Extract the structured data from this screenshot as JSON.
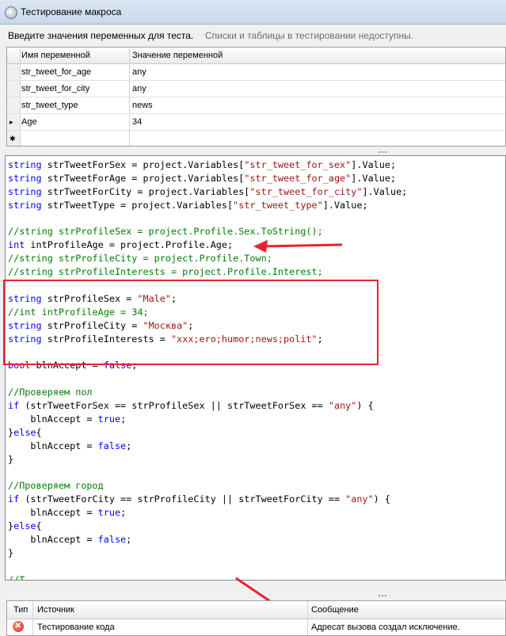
{
  "window": {
    "title": "Тестирование макроса",
    "icon": "gear-icon"
  },
  "info": {
    "main": "Введите значения переменных для теста.",
    "secondary": "Списки и таблицы в тестировании недоступны."
  },
  "variables": {
    "columns": [
      "Имя переменной",
      "Значение переменной"
    ],
    "rows": [
      {
        "name": "str_tweet_for_age",
        "value": "any"
      },
      {
        "name": "str_tweet_for_city",
        "value": "any"
      },
      {
        "name": "str_tweet_type",
        "value": "news"
      },
      {
        "name": "Age",
        "value": "34"
      }
    ],
    "current_row_marker": "▸",
    "new_row_marker": "✱"
  },
  "code_lines": [
    [
      [
        "kw",
        "string"
      ],
      [
        "t",
        " strTweetForSex = project.Variables["
      ],
      [
        "str",
        "\"str_tweet_for_sex\""
      ],
      [
        "t",
        "].Value;"
      ]
    ],
    [
      [
        "kw",
        "string"
      ],
      [
        "t",
        " strTweetForAge = project.Variables["
      ],
      [
        "str",
        "\"str_tweet_for_age\""
      ],
      [
        "t",
        "].Value;"
      ]
    ],
    [
      [
        "kw",
        "string"
      ],
      [
        "t",
        " strTweetForCity = project.Variables["
      ],
      [
        "str",
        "\"str_tweet_for_city\""
      ],
      [
        "t",
        "].Value;"
      ]
    ],
    [
      [
        "kw",
        "string"
      ],
      [
        "t",
        " strTweetType = project.Variables["
      ],
      [
        "str",
        "\"str_tweet_type\""
      ],
      [
        "t",
        "].Value;"
      ]
    ],
    [],
    [
      [
        "cm",
        "//string strProfileSex = project.Profile.Sex.ToString();"
      ]
    ],
    [
      [
        "kw",
        "int"
      ],
      [
        "t",
        " intProfileAge = project.Profile.Age;"
      ]
    ],
    [
      [
        "cm",
        "//string strProfileCity = project.Profile.Town;"
      ]
    ],
    [
      [
        "cm",
        "//string strProfileInterests = project.Profile.Interest;"
      ]
    ],
    [],
    [
      [
        "kw",
        "string"
      ],
      [
        "t",
        " strProfileSex = "
      ],
      [
        "str",
        "\"Male\""
      ],
      [
        "t",
        ";"
      ]
    ],
    [
      [
        "cm",
        "//int intProfileAge = 34;"
      ]
    ],
    [
      [
        "kw",
        "string"
      ],
      [
        "t",
        " strProfileCity = "
      ],
      [
        "str",
        "\"Москва\""
      ],
      [
        "t",
        ";"
      ]
    ],
    [
      [
        "kw",
        "string"
      ],
      [
        "t",
        " strProfileInterests = "
      ],
      [
        "str",
        "\"xxx;ero;humor;news;polit\""
      ],
      [
        "t",
        ";"
      ]
    ],
    [],
    [
      [
        "kw",
        "bool"
      ],
      [
        "t",
        " blnAccept = "
      ],
      [
        "kw",
        "false"
      ],
      [
        "t",
        ";"
      ]
    ],
    [],
    [
      [
        "cm",
        "//Проверяем пол"
      ]
    ],
    [
      [
        "kw",
        "if"
      ],
      [
        "t",
        " (strTweetForSex == strProfileSex || strTweetForSex == "
      ],
      [
        "str",
        "\"any\""
      ],
      [
        "t",
        ") {"
      ]
    ],
    [
      [
        "t",
        "    blnAccept = "
      ],
      [
        "kw",
        "true"
      ],
      [
        "t",
        ";"
      ]
    ],
    [
      [
        "t",
        "}"
      ],
      [
        "kw",
        "else"
      ],
      [
        "t",
        "{"
      ]
    ],
    [
      [
        "t",
        "    blnAccept = "
      ],
      [
        "kw",
        "false"
      ],
      [
        "t",
        ";"
      ]
    ],
    [
      [
        "t",
        "}"
      ]
    ],
    [],
    [
      [
        "cm",
        "//Проверяем город"
      ]
    ],
    [
      [
        "kw",
        "if"
      ],
      [
        "t",
        " (strTweetForCity == strProfileCity || strTweetForCity == "
      ],
      [
        "str",
        "\"any\""
      ],
      [
        "t",
        ") {"
      ]
    ],
    [
      [
        "t",
        "    blnAccept = "
      ],
      [
        "kw",
        "true"
      ],
      [
        "t",
        ";"
      ]
    ],
    [
      [
        "t",
        "}"
      ],
      [
        "kw",
        "else"
      ],
      [
        "t",
        "{"
      ]
    ],
    [
      [
        "t",
        "    blnAccept = "
      ],
      [
        "kw",
        "false"
      ],
      [
        "t",
        ";"
      ]
    ],
    [
      [
        "t",
        "}"
      ]
    ],
    [],
    [
      [
        "cm",
        "//T"
      ]
    ]
  ],
  "errors": {
    "columns": [
      "Тип",
      "Источник",
      "Сообщение"
    ],
    "rows": [
      {
        "type_icon": "error-icon",
        "source": "Тестирование кода",
        "message": "Адресат вызова создал исключение."
      }
    ]
  },
  "colors": {
    "keyword": "#0000ff",
    "string": "#a31515",
    "comment": "#008000",
    "annotation": "#e8232f"
  }
}
